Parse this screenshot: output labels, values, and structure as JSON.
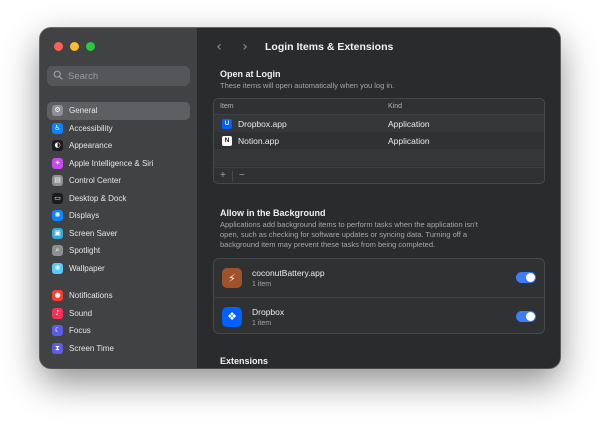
{
  "sidebar": {
    "search_placeholder": "Search",
    "groups": [
      [
        {
          "label": "General",
          "icon": "gear-icon",
          "color": "#8e8e93",
          "glyph": "⚙",
          "selected": true
        },
        {
          "label": "Accessibility",
          "icon": "accessibility-icon",
          "color": "#0a84ff",
          "glyph": "♿"
        },
        {
          "label": "Appearance",
          "icon": "appearance-icon",
          "color": "#1c1c1e",
          "glyph": "◐"
        },
        {
          "label": "Apple Intelligence & Siri",
          "icon": "siri-icon",
          "color": "#c64cf0",
          "glyph": "✦"
        },
        {
          "label": "Control Center",
          "icon": "control-center-icon",
          "color": "#8e8e93",
          "glyph": "▤"
        },
        {
          "label": "Desktop & Dock",
          "icon": "dock-icon",
          "color": "#1c1c1e",
          "glyph": "▭"
        },
        {
          "label": "Displays",
          "icon": "displays-icon",
          "color": "#0a84ff",
          "glyph": "✺"
        },
        {
          "label": "Screen Saver",
          "icon": "screen-saver-icon",
          "color": "#34aadc",
          "glyph": "▣"
        },
        {
          "label": "Spotlight",
          "icon": "spotlight-icon",
          "color": "#8e8e93",
          "glyph": "⌕"
        },
        {
          "label": "Wallpaper",
          "icon": "wallpaper-icon",
          "color": "#5ac8fa",
          "glyph": "❀"
        }
      ],
      [
        {
          "label": "Notifications",
          "icon": "notifications-icon",
          "color": "#ff3b30",
          "glyph": "●"
        },
        {
          "label": "Sound",
          "icon": "sound-icon",
          "color": "#ff2d55",
          "glyph": "♪"
        },
        {
          "label": "Focus",
          "icon": "focus-icon",
          "color": "#5e5ce6",
          "glyph": "☾"
        },
        {
          "label": "Screen Time",
          "icon": "screen-time-icon",
          "color": "#5e5ce6",
          "glyph": "⧗"
        }
      ]
    ]
  },
  "header": {
    "title": "Login Items & Extensions"
  },
  "open_at_login": {
    "title": "Open at Login",
    "subtitle": "These items will open automatically when you log in.",
    "columns": {
      "item": "Item",
      "kind": "Kind"
    },
    "rows": [
      {
        "name": "Dropbox.app",
        "kind": "Application",
        "icon": "dropbox-icon",
        "icon_color": "#0061fe",
        "icon_glyph": "U"
      },
      {
        "name": "Notion.app",
        "kind": "Application",
        "icon": "notion-icon",
        "icon_color": "#ffffff",
        "icon_glyph": "N"
      }
    ],
    "add_label": "+",
    "remove_label": "−"
  },
  "background": {
    "title": "Allow in the Background",
    "description_lines": [
      "Applications add background items to perform tasks when the application isn't",
      "open, such as checking for software updates or syncing data. Turning off a",
      "background item may prevent these tasks from being completed."
    ],
    "items": [
      {
        "name": "coconutBattery.app",
        "count": "1 item",
        "enabled": true,
        "icon": "coconutbattery-icon",
        "icon_color": "#a0522d",
        "icon_glyph": "⚡"
      },
      {
        "name": "Dropbox",
        "count": "1 item",
        "enabled": true,
        "icon": "dropbox-icon",
        "icon_color": "#0061fe",
        "icon_glyph": "❖"
      }
    ]
  },
  "extensions": {
    "title": "Extensions"
  },
  "colors": {
    "toggle_on": "#3d7bf7",
    "selection": "#5e5f62"
  }
}
